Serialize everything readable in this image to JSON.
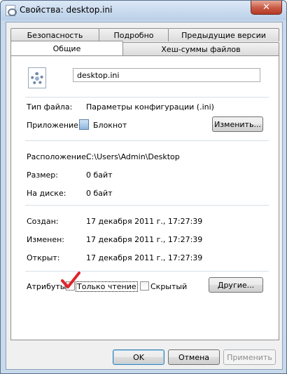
{
  "window": {
    "title": "Свойства: desktop.ini",
    "close_label": "✕"
  },
  "tabs": {
    "row1": [
      "Безопасность",
      "Подробно",
      "Предыдущие версии"
    ],
    "row2_active": "Общие",
    "row2_other": "Хеш-суммы файлов"
  },
  "general": {
    "file_name": "desktop.ini",
    "file_type_label": "Тип файла:",
    "file_type_value": "Параметры конфигурации (.ini)",
    "app_label": "Приложение:",
    "app_value": "Блокнот",
    "change_button": "Изменить...",
    "location_label": "Расположение:",
    "location_value": "C:\\Users\\Admin\\Desktop",
    "size_label": "Размер:",
    "size_value": "0 байт",
    "disk_label": "На диске:",
    "disk_value": "0 байт",
    "created_label": "Создан:",
    "created_value": "17 декабря 2011 г., 17:27:39",
    "modified_label": "Изменен:",
    "modified_value": "17 декабря 2011 г., 17:27:39",
    "opened_label": "Открыт:",
    "opened_value": "17 декабря 2011 г., 17:27:39",
    "attributes_label": "Атрибуты:",
    "readonly_label": "Только чтение",
    "hidden_label": "Скрытый",
    "other_button": "Другие..."
  },
  "footer": {
    "ok": "OK",
    "cancel": "Отмена",
    "apply": "Применить"
  },
  "colors": {
    "check_mark": "#e0242a",
    "window_frame": "#c8d9ec"
  }
}
